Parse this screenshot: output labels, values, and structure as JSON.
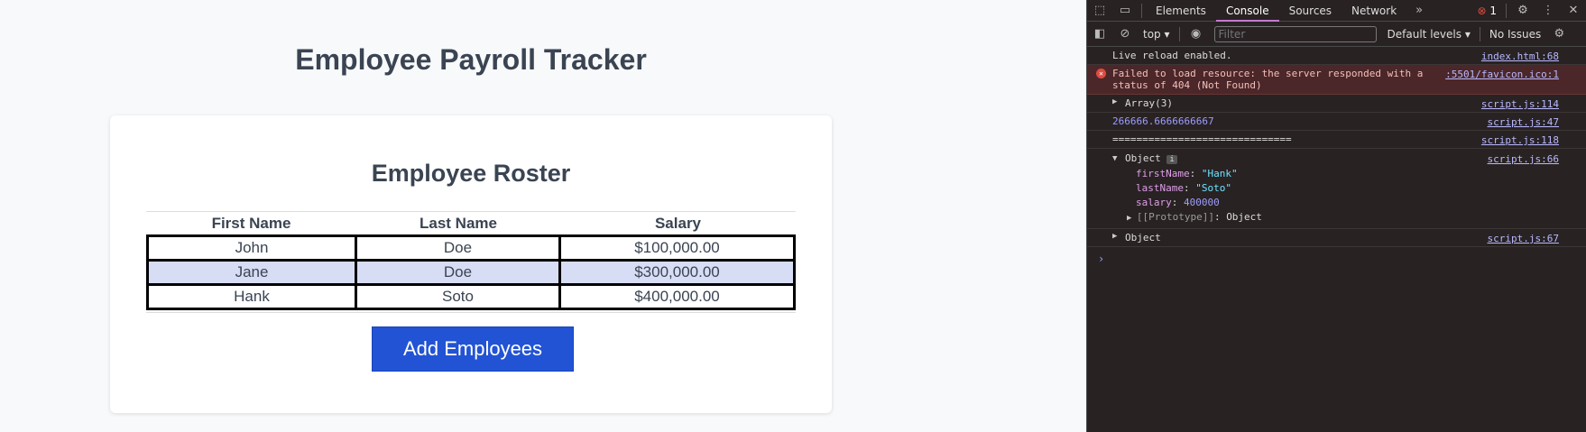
{
  "app": {
    "title": "Employee Payroll Tracker",
    "roster_title": "Employee Roster",
    "columns": [
      "First Name",
      "Last Name",
      "Salary"
    ],
    "rows": [
      {
        "first": "John",
        "last": "Doe",
        "salary": "$100,000.00"
      },
      {
        "first": "Jane",
        "last": "Doe",
        "salary": "$300,000.00"
      },
      {
        "first": "Hank",
        "last": "Soto",
        "salary": "$400,000.00"
      }
    ],
    "add_button": "Add Employees"
  },
  "devtools": {
    "tabs": [
      "Elements",
      "Console",
      "Sources",
      "Network"
    ],
    "active_tab": "Console",
    "more_tabs": "»",
    "error_count": "1",
    "context": "top",
    "filter_placeholder": "Filter",
    "levels": "Default levels",
    "issues": "No Issues",
    "messages": {
      "live_reload": {
        "text": "Live reload enabled.",
        "source": "index.html:68"
      },
      "error": {
        "text": "Failed to load resource: the server responded with a status of 404 (Not Found)",
        "source": ":5501/favicon.ico:1"
      },
      "array": {
        "text": "Array(3)",
        "source": "script.js:114"
      },
      "average": {
        "text": "266666.6666666667",
        "source": "script.js:47"
      },
      "divider": {
        "text": "==============================",
        "source": "script.js:118"
      },
      "object": {
        "text": "Object",
        "source": "script.js:66",
        "props": {
          "firstName_key": "firstName",
          "firstName_val": "\"Hank\"",
          "lastName_key": "lastName",
          "lastName_val": "\"Soto\"",
          "salary_key": "salary",
          "salary_val": "400000",
          "proto_key": "[[Prototype]]",
          "proto_val": "Object"
        }
      },
      "object2": {
        "text": "Object",
        "source": "script.js:67"
      }
    },
    "prompt": "›"
  }
}
